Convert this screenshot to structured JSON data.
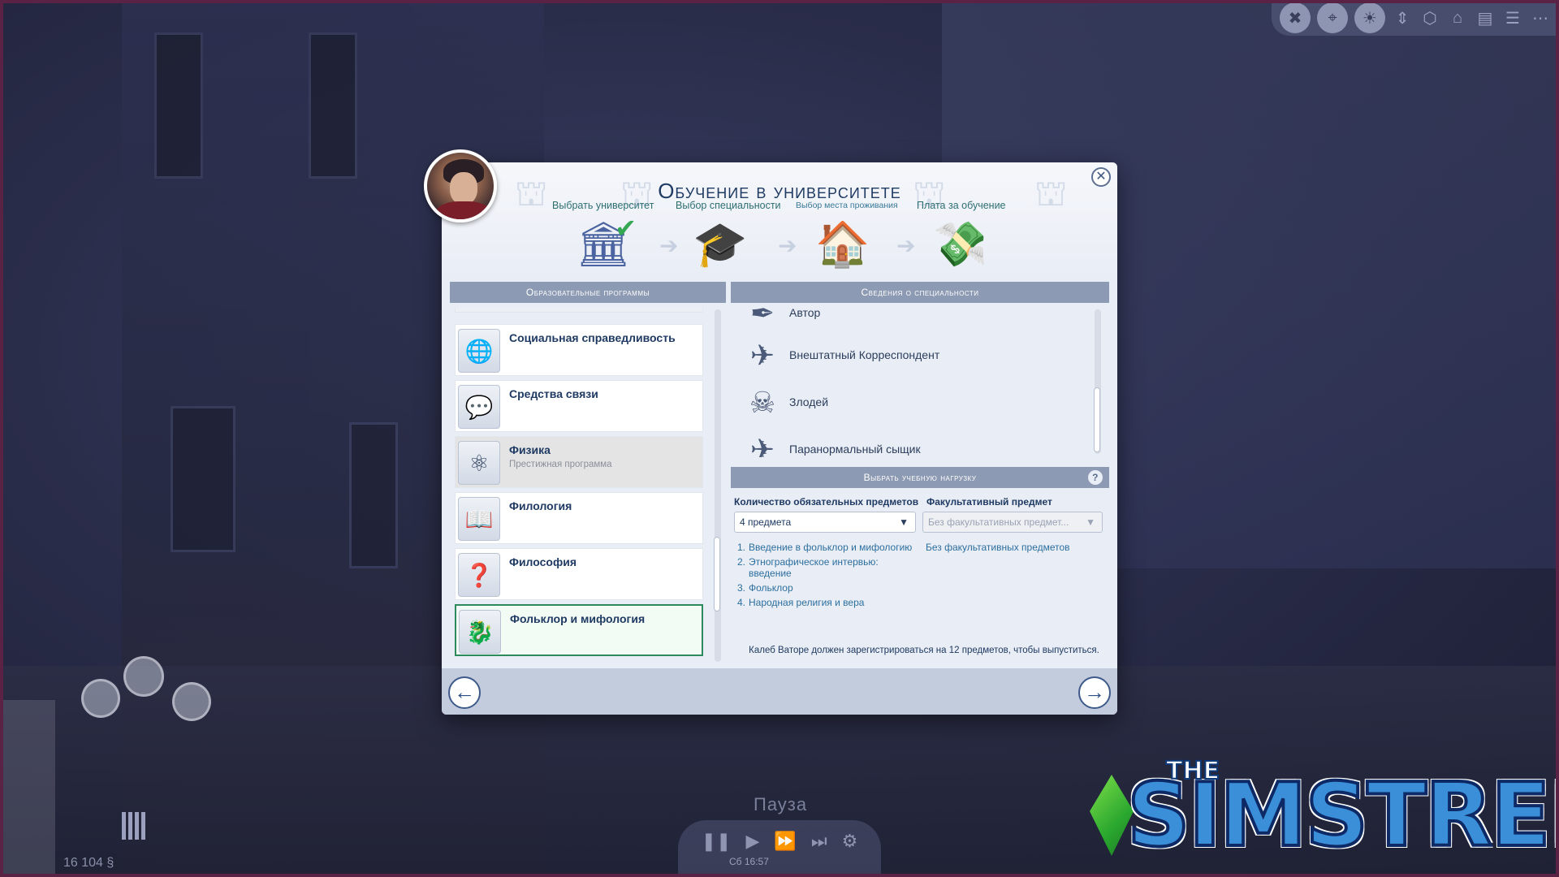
{
  "dialog": {
    "title": "Обучение в университете",
    "close_symbol": "✕"
  },
  "steps": [
    {
      "label": "Выбрать университет",
      "icon": "university-icon",
      "state": "done"
    },
    {
      "label": "Выбор специальности",
      "icon": "graduation-cap-icon",
      "state": "current"
    },
    {
      "label": "Выбор места проживания",
      "icon": "house-icon",
      "state": "future"
    },
    {
      "label": "Плата за обучение",
      "icon": "money-icon",
      "state": "future"
    }
  ],
  "left_panel": {
    "header": "Образовательные программы",
    "items": [
      {
        "name": "Социальная справедливость",
        "subtitle": "",
        "icon": "globe-icon",
        "state": "normal"
      },
      {
        "name": "Средства связи",
        "subtitle": "",
        "icon": "speech-bubbles-icon",
        "state": "normal"
      },
      {
        "name": "Физика",
        "subtitle": "Престижная программа",
        "icon": "atom-icon",
        "state": "selected-gray"
      },
      {
        "name": "Филология",
        "subtitle": "",
        "icon": "book-icon",
        "state": "normal"
      },
      {
        "name": "Философия",
        "subtitle": "",
        "icon": "question-cup-icon",
        "state": "normal"
      },
      {
        "name": "Фольклор и мифология",
        "subtitle": "",
        "icon": "dragon-icon",
        "state": "active"
      }
    ]
  },
  "right_panel": {
    "header": "Сведения о специальности",
    "careers": [
      {
        "name": "Автор",
        "icon": "quill-icon"
      },
      {
        "name": "Внештатный Корреспондент",
        "icon": "paper-plane-icon"
      },
      {
        "name": "Злодей",
        "icon": "villain-icon"
      },
      {
        "name": "Паранормальный сыщик",
        "icon": "paper-plane-icon"
      }
    ],
    "load_header": "Выбрать учебную нагрузку",
    "help_symbol": "?",
    "required_label": "Количество обязательных предметов",
    "required_value": "4 предмета",
    "elective_label": "Факультативный предмет",
    "elective_value": "Без факультативных предмет...",
    "courses": [
      {
        "num": "1.",
        "name": "Введение в фольклор и мифологию"
      },
      {
        "num": "2.",
        "name": "Этнографическое интервью: введение"
      },
      {
        "num": "3.",
        "name": "Фольклор"
      },
      {
        "num": "4.",
        "name": "Народная религия и вера"
      }
    ],
    "elective_none": "Без факультативных предметов",
    "footer_note": "Калеб Ваторе должен зарегистрироваться на 12 предметов, чтобы выпуститься."
  },
  "nav": {
    "back_symbol": "←",
    "next_symbol": "→"
  },
  "hud": {
    "pause": "Пауза",
    "clock": "Сб 16:57",
    "funds": "16 104 §"
  },
  "watermark": {
    "the": "THE",
    "brand": "SIMSTREE"
  },
  "colors": {
    "accent": "#1f3a63",
    "step_done": "#34a853",
    "panel_header": "#8d9ab3",
    "active_border": "#2c8a5c"
  }
}
